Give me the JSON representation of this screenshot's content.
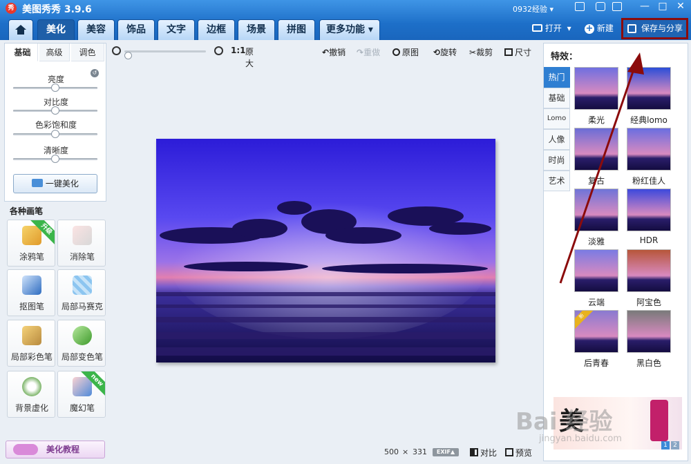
{
  "app": {
    "logo": "秀",
    "title": "美图秀秀 3.9.6",
    "account": "0932经验 ▾"
  },
  "nav": {
    "tabs": [
      {
        "label": "美化",
        "active": true
      },
      {
        "label": "美容"
      },
      {
        "label": "饰品"
      },
      {
        "label": "文字"
      },
      {
        "label": "边框"
      },
      {
        "label": "场景"
      },
      {
        "label": "拼图"
      },
      {
        "label": "更多功能 ▾"
      }
    ]
  },
  "top_actions": {
    "open": "打开",
    "new": "新建",
    "save_share": "保存与分享"
  },
  "left_panel": {
    "tabs": [
      "基础",
      "高级",
      "调色"
    ],
    "sliders": [
      {
        "label": "亮度",
        "value": 0.5
      },
      {
        "label": "对比度",
        "value": 0.5
      },
      {
        "label": "色彩饱和度",
        "value": 0.5
      },
      {
        "label": "清晰度",
        "value": 0.5
      }
    ],
    "one_click": "一键美化",
    "brush_title": "各种画笔",
    "brushes": [
      {
        "label": "涂鸦笔",
        "badge": "升级"
      },
      {
        "label": "消除笔"
      },
      {
        "label": "抠图笔"
      },
      {
        "label": "局部马赛克"
      },
      {
        "label": "局部彩色笔"
      },
      {
        "label": "局部变色笔"
      },
      {
        "label": "背景虚化"
      },
      {
        "label": "魔幻笔",
        "badge": "new"
      }
    ],
    "tutorial": "美化教程"
  },
  "toolbar": {
    "ratio": "1:1",
    "original_size": "原大",
    "undo": "撤销",
    "redo": "重做",
    "original": "原图",
    "rotate": "旋转",
    "crop": "裁剪",
    "size": "尺寸"
  },
  "status": {
    "width": "500",
    "times": "×",
    "height": "331",
    "exif": "EXIF▲",
    "compare": "对比",
    "preview": "预览"
  },
  "effects": {
    "title": "特效：",
    "tabs": [
      {
        "label": "热门",
        "active": true
      },
      {
        "label": "基础"
      },
      {
        "label": "Lomo"
      },
      {
        "label": "人像"
      },
      {
        "label": "时尚"
      },
      {
        "label": "艺术"
      }
    ],
    "items": [
      {
        "label": "柔光",
        "tint": "#6f6fe0"
      },
      {
        "label": "经典lomo",
        "tint": "#2b4ed8"
      },
      {
        "label": "复古",
        "tint": "#6b6dd6"
      },
      {
        "label": "粉红佳人",
        "tint": "#6b6ee0"
      },
      {
        "label": "淡雅",
        "tint": "#6f74d8"
      },
      {
        "label": "HDR",
        "tint": "#3d49dc"
      },
      {
        "label": "云端",
        "tint": "#7b7be3"
      },
      {
        "label": "阿宝色",
        "tint": "#b7563a"
      },
      {
        "label": "后青春",
        "tint": "#8a7ad0",
        "badge": "新"
      },
      {
        "label": "黑白色",
        "tint": "#7a7a7a"
      }
    ],
    "ad": {
      "text": "美",
      "pages": [
        "1",
        "2"
      ]
    }
  },
  "watermark": {
    "main": "Bai 经验",
    "sub": "jingyan.baidu.com"
  }
}
